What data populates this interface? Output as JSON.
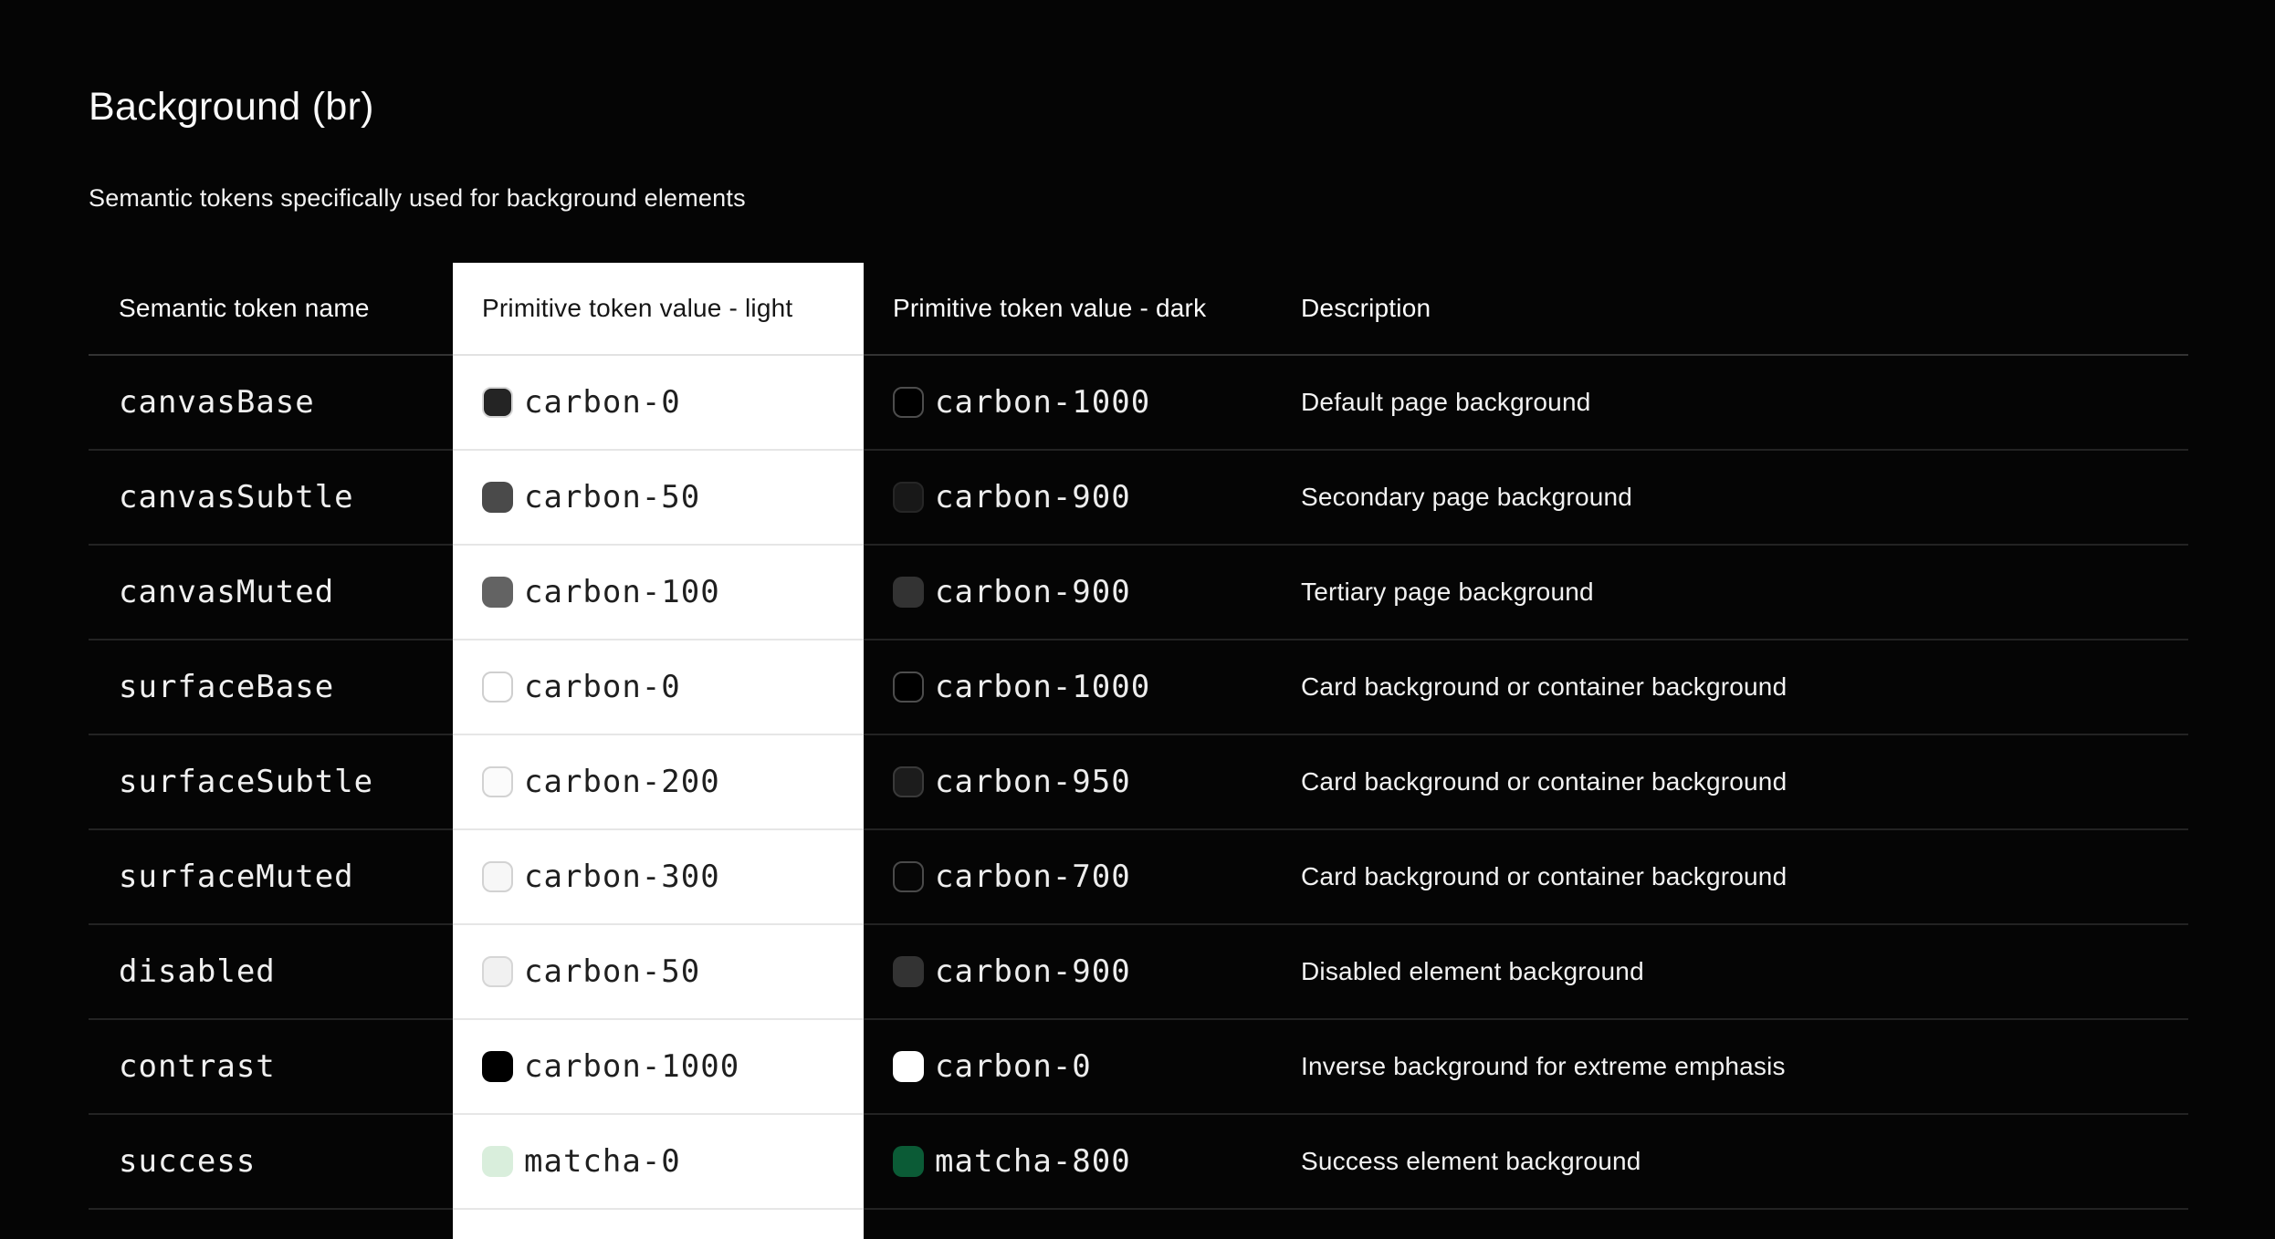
{
  "page": {
    "title": "Background (br)",
    "subtitle": "Semantic tokens specifically used for background elements"
  },
  "colors": {
    "page_background": "#050505",
    "light_column_background": "#ffffff",
    "success_light": "#d9eedc",
    "success_dark": "#0b5b36"
  },
  "table": {
    "columns": [
      "Semantic token name",
      "Primitive token value - light",
      "Primitive token value - dark",
      "Description"
    ],
    "rows": [
      {
        "name": "canvasBase",
        "light": {
          "token": "carbon-0",
          "swatch": "#242424",
          "border": "#d5d5d5"
        },
        "dark": {
          "token": "carbon-1000",
          "swatch": "#000000",
          "border": "#4d4d4d"
        },
        "description": "Default page background"
      },
      {
        "name": "canvasSubtle",
        "light": {
          "token": "carbon-50",
          "swatch": "#4a4a4a"
        },
        "dark": {
          "token": "carbon-900",
          "swatch": "#181818",
          "border": "#262626"
        },
        "description": "Secondary page background"
      },
      {
        "name": "canvasMuted",
        "light": {
          "token": "carbon-100",
          "swatch": "#636363"
        },
        "dark": {
          "token": "carbon-900",
          "swatch": "#333333"
        },
        "description": "Tertiary page background"
      },
      {
        "name": "surfaceBase",
        "light": {
          "token": "carbon-0",
          "swatch": "#ffffff",
          "border": "#cfcfcf"
        },
        "dark": {
          "token": "carbon-1000",
          "swatch": "#000000",
          "border": "#4d4d4d"
        },
        "description": "Card background or container background"
      },
      {
        "name": "surfaceSubtle",
        "light": {
          "token": "carbon-200",
          "swatch": "#fbfbfb",
          "border": "#d2d2d2"
        },
        "dark": {
          "token": "carbon-950",
          "swatch": "#1c1c1c",
          "border": "#3a3a3a"
        },
        "description": "Card background or container background"
      },
      {
        "name": "surfaceMuted",
        "light": {
          "token": "carbon-300",
          "swatch": "#f7f7f7",
          "border": "#d2d2d2"
        },
        "dark": {
          "token": "carbon-700",
          "swatch": "#060606",
          "border": "#4a4a4a"
        },
        "description": "Card background or container background"
      },
      {
        "name": "disabled",
        "light": {
          "token": "carbon-50",
          "swatch": "#f1f1f1",
          "border": "#d6d6d6"
        },
        "dark": {
          "token": "carbon-900",
          "swatch": "#333333"
        },
        "description": "Disabled element background"
      },
      {
        "name": "contrast",
        "light": {
          "token": "carbon-1000",
          "swatch": "#000000"
        },
        "dark": {
          "token": "carbon-0",
          "swatch": "#ffffff"
        },
        "description": "Inverse background for extreme emphasis"
      },
      {
        "name": "success",
        "light": {
          "token": "matcha-0",
          "swatch": "#d9eedc"
        },
        "dark": {
          "token": "matcha-800",
          "swatch": "#0b5b36"
        },
        "description": "Success element background"
      }
    ]
  }
}
